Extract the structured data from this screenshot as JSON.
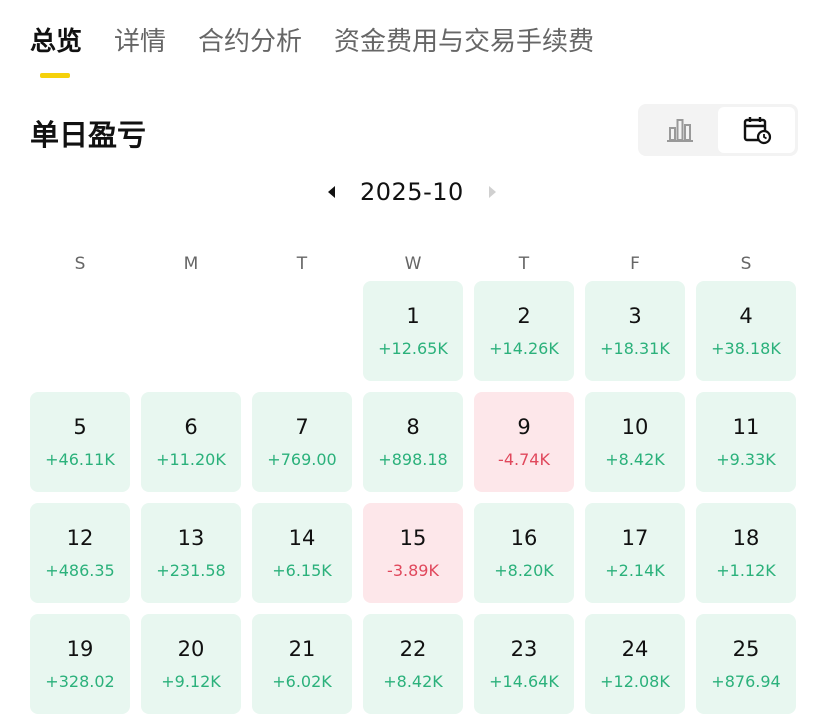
{
  "tabs": [
    "总览",
    "详情",
    "合约分析",
    "资金费用与交易手续费"
  ],
  "active_tab_index": 0,
  "section_title": "单日盈亏",
  "view_toggle": {
    "options": [
      "bar-chart-icon",
      "calendar-icon"
    ],
    "selected": "calendar-icon"
  },
  "month_label": "2025-10",
  "weekdays": [
    "S",
    "M",
    "T",
    "W",
    "T",
    "F",
    "S"
  ],
  "colors": {
    "gain_bg": "#e8f7f0",
    "gain_text": "#2bb17b",
    "loss_bg": "#fde7ea",
    "loss_text": "#e0485c",
    "accent": "#f5d10a"
  },
  "calendar": {
    "leading_blanks": 3,
    "days": [
      {
        "day": "1",
        "pnl": "+12.65K",
        "type": "gain"
      },
      {
        "day": "2",
        "pnl": "+14.26K",
        "type": "gain"
      },
      {
        "day": "3",
        "pnl": "+18.31K",
        "type": "gain"
      },
      {
        "day": "4",
        "pnl": "+38.18K",
        "type": "gain"
      },
      {
        "day": "5",
        "pnl": "+46.11K",
        "type": "gain"
      },
      {
        "day": "6",
        "pnl": "+11.20K",
        "type": "gain"
      },
      {
        "day": "7",
        "pnl": "+769.00",
        "type": "gain"
      },
      {
        "day": "8",
        "pnl": "+898.18",
        "type": "gain"
      },
      {
        "day": "9",
        "pnl": "-4.74K",
        "type": "loss"
      },
      {
        "day": "10",
        "pnl": "+8.42K",
        "type": "gain"
      },
      {
        "day": "11",
        "pnl": "+9.33K",
        "type": "gain"
      },
      {
        "day": "12",
        "pnl": "+486.35",
        "type": "gain"
      },
      {
        "day": "13",
        "pnl": "+231.58",
        "type": "gain"
      },
      {
        "day": "14",
        "pnl": "+6.15K",
        "type": "gain"
      },
      {
        "day": "15",
        "pnl": "-3.89K",
        "type": "loss"
      },
      {
        "day": "16",
        "pnl": "+8.20K",
        "type": "gain"
      },
      {
        "day": "17",
        "pnl": "+2.14K",
        "type": "gain"
      },
      {
        "day": "18",
        "pnl": "+1.12K",
        "type": "gain"
      },
      {
        "day": "19",
        "pnl": "+328.02",
        "type": "gain"
      },
      {
        "day": "20",
        "pnl": "+9.12K",
        "type": "gain"
      },
      {
        "day": "21",
        "pnl": "+6.02K",
        "type": "gain"
      },
      {
        "day": "22",
        "pnl": "+8.42K",
        "type": "gain"
      },
      {
        "day": "23",
        "pnl": "+14.64K",
        "type": "gain"
      },
      {
        "day": "24",
        "pnl": "+12.08K",
        "type": "gain"
      },
      {
        "day": "25",
        "pnl": "+876.94",
        "type": "gain"
      }
    ]
  }
}
